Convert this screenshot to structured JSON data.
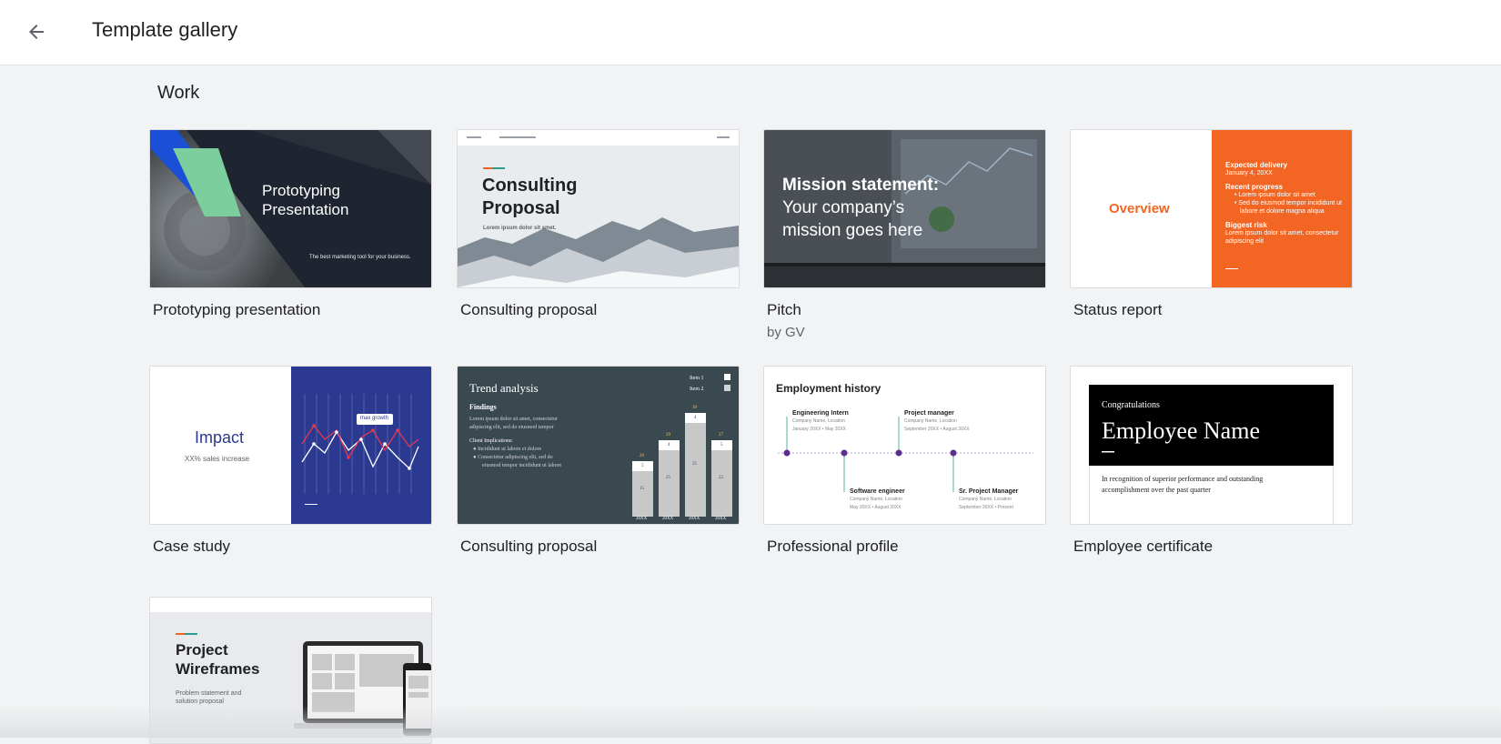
{
  "header": {
    "title": "Template gallery"
  },
  "section": {
    "title": "Work"
  },
  "templates": [
    {
      "title": "Prototyping presentation",
      "thumb": {
        "heading_line1": "Prototyping",
        "heading_line2": "Presentation",
        "tagline": "The best marketing tool for your business."
      }
    },
    {
      "title": "Consulting proposal",
      "thumb": {
        "heading_line1": "Consulting",
        "heading_line2": "Proposal",
        "subtitle": "Lorem ipsum dolor sit amet."
      }
    },
    {
      "title": "Pitch",
      "subtitle": "by GV",
      "thumb": {
        "line1": "Mission statement:",
        "line2": "Your company’s",
        "line3": "mission goes here"
      }
    },
    {
      "title": "Status report",
      "thumb": {
        "overview": "Overview",
        "delivery_title": "Expected delivery",
        "delivery_date": "January 4, 20XX",
        "progress_title": "Recent progress",
        "progress_items": [
          "Lorem ipsum dolor sit amet",
          "Sed do eiusmod tempor incididunt ut",
          "labore et dolore magna aliqua"
        ],
        "risk_title": "Biggest risk",
        "risk_text": [
          "Lorem ipsum dolor sit amet, consectetur",
          "adipiscing elit"
        ]
      }
    },
    {
      "title": "Case study",
      "thumb": {
        "heading": "Impact",
        "subtitle": "XX% sales increase",
        "callout": "max growth"
      }
    },
    {
      "title": "Consulting proposal",
      "thumb": {
        "heading": "Trend analysis",
        "findings": "Findings",
        "body": [
          "Lorem ipsum dolor sit amet, consectetur",
          "adipiscing elit, sed do eiusmod tempor"
        ],
        "implications_title": "Client Implications:",
        "bullets": [
          "Incididunt ut labore et dolore",
          "Consectetur adipiscing elit, sed do",
          "eiusmod tempor incididunt ut labore"
        ],
        "legend": [
          "Item 1",
          "Item 2"
        ],
        "bars": [
          {
            "label": "20XX",
            "top": "20",
            "mid": "5",
            "low": "15"
          },
          {
            "label": "20XX",
            "top": "29",
            "mid": "4",
            "low": "25"
          },
          {
            "label": "20XX",
            "top": "39",
            "mid": "4",
            "low": "35"
          },
          {
            "label": "20XX",
            "top": "27",
            "mid": "5",
            "low": "22"
          }
        ]
      }
    },
    {
      "title": "Professional profile",
      "thumb": {
        "heading": "Employment history",
        "jobs": [
          {
            "title": "Engineering Intern",
            "l1": "Company Name, Location",
            "l2": "January 20XX • May 20XX"
          },
          {
            "title": "Project manager",
            "l1": "Company Name, Location",
            "l2": "September 20XX • August 20XX"
          },
          {
            "title": "Software engineer",
            "l1": "Company Name, Location",
            "l2": "May 20XX • August 20XX"
          },
          {
            "title": "Sr. Project Manager",
            "l1": "Company Name, Location",
            "l2": "September 20XX • Present"
          }
        ]
      }
    },
    {
      "title": "Employee certificate",
      "thumb": {
        "congrats": "Congratulations",
        "name": "Employee Name",
        "body1": "In recognition of superior performance and outstanding",
        "body2": "accomplishment over the past quarter"
      }
    },
    {
      "title": "",
      "thumb": {
        "heading_line1": "Project",
        "heading_line2": "Wireframes",
        "sub1": "Problem statement and",
        "sub2": "solution proposal"
      }
    }
  ],
  "colors": {
    "accent_orange": "#f26522",
    "navy": "#2b3990",
    "slate": "#3a4850",
    "purple": "#5c2d91",
    "teal": "#2a9d8f"
  },
  "icons": {
    "back": "arrow-back-icon"
  }
}
